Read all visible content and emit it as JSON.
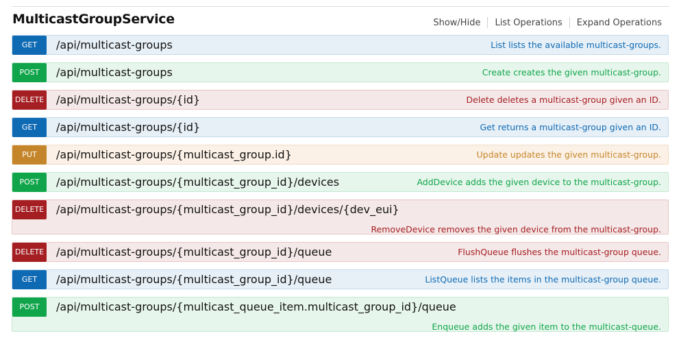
{
  "service": {
    "title": "MulticastGroupService",
    "actions": {
      "show_hide": "Show/Hide",
      "list_operations": "List Operations",
      "expand_operations": "Expand Operations"
    }
  },
  "operations": [
    {
      "method": "GET",
      "path": "/api/multicast-groups",
      "description": "List lists the available multicast-groups."
    },
    {
      "method": "POST",
      "path": "/api/multicast-groups",
      "description": "Create creates the given multicast-group."
    },
    {
      "method": "DELETE",
      "path": "/api/multicast-groups/{id}",
      "description": "Delete deletes a multicast-group given an ID."
    },
    {
      "method": "GET",
      "path": "/api/multicast-groups/{id}",
      "description": "Get returns a multicast-group given an ID."
    },
    {
      "method": "PUT",
      "path": "/api/multicast-groups/{multicast_group.id}",
      "description": "Update updates the given multicast-group."
    },
    {
      "method": "POST",
      "path": "/api/multicast-groups/{multicast_group_id}/devices",
      "description": "AddDevice adds the given device to the multicast-group."
    },
    {
      "method": "DELETE",
      "path": "/api/multicast-groups/{multicast_group_id}/devices/{dev_eui}",
      "description": "RemoveDevice removes the given device from the multicast-group."
    },
    {
      "method": "DELETE",
      "path": "/api/multicast-groups/{multicast_group_id}/queue",
      "description": "FlushQueue flushes the multicast-group queue."
    },
    {
      "method": "GET",
      "path": "/api/multicast-groups/{multicast_group_id}/queue",
      "description": "ListQueue lists the items in the multicast-group queue."
    },
    {
      "method": "POST",
      "path": "/api/multicast-groups/{multicast_queue_item.multicast_group_id}/queue",
      "description": "Enqueue adds the given item to the multicast-queue."
    }
  ],
  "colors": {
    "get": "#0f6ab4",
    "post": "#10a54a",
    "delete": "#a41e22",
    "put": "#c5862b"
  }
}
